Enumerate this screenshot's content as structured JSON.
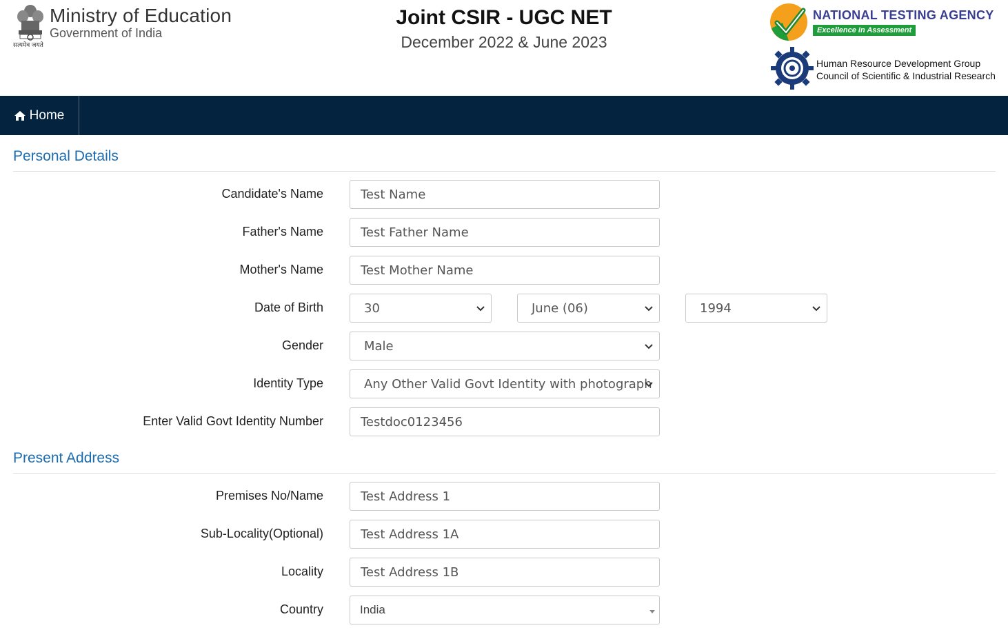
{
  "header": {
    "ministry_title": "Ministry of Education",
    "ministry_subtitle": "Government of India",
    "emblem_caption": "सत्यमेव जयते",
    "exam_title": "Joint CSIR - UGC NET",
    "exam_session": "December 2022 & June 2023",
    "nta_name": "NATIONAL TESTING AGENCY",
    "nta_tagline": "Excellence in Assessment",
    "csir_line1": "Human Resource Development Group",
    "csir_line2": "Council of Scientific & Industrial Research"
  },
  "nav": {
    "home_label": "Home"
  },
  "personal": {
    "section_title": "Personal Details",
    "candidate_name_label": "Candidate's Name",
    "candidate_name_value": "Test Name",
    "father_name_label": "Father's Name",
    "father_name_value": "Test Father Name",
    "mother_name_label": "Mother's Name",
    "mother_name_value": "Test Mother Name",
    "dob_label": "Date of Birth",
    "dob_day": "30",
    "dob_month": "June (06)",
    "dob_year": "1994",
    "gender_label": "Gender",
    "gender_value": "Male",
    "identity_type_label": "Identity Type",
    "identity_type_value": "Any Other Valid Govt Identity with photograph",
    "identity_number_label": "Enter Valid Govt Identity Number",
    "identity_number_value": "Testdoc0123456"
  },
  "address": {
    "section_title": "Present Address",
    "premises_label": "Premises No/Name",
    "premises_value": "Test Address 1",
    "sublocality_label": "Sub-Locality(Optional)",
    "sublocality_value": "Test Address 1A",
    "locality_label": "Locality",
    "locality_value": "Test Address 1B",
    "country_label": "Country",
    "country_value": "India"
  },
  "colors": {
    "nav_bg": "#04233f",
    "section_title": "#1b6bb0",
    "nta_blue": "#3a3e92",
    "nta_green": "#1f9d3a"
  }
}
